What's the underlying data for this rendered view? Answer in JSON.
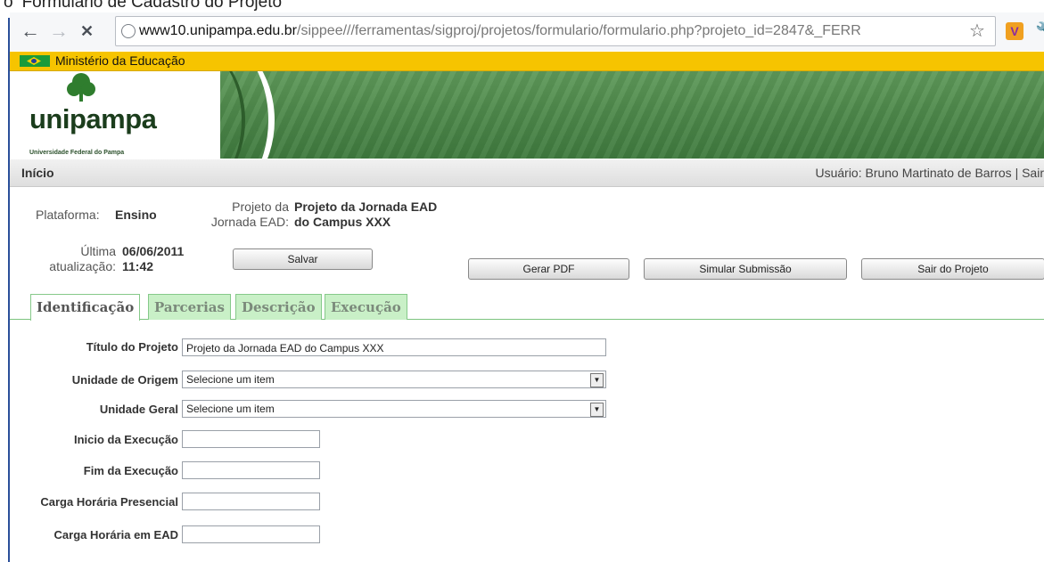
{
  "caption": {
    "text": "Formulário de Cadastro do Projeto"
  },
  "browser": {
    "url_host": "www10.unipampa.edu.br",
    "url_path": "/sippee///ferramentas/sigproj/projetos/formulario/formulario.php?projeto_id=2847&_FERR",
    "back": "←",
    "forward": "→",
    "stop": "✕"
  },
  "ministry": {
    "label": "Ministério da Educação"
  },
  "header": {
    "logo_word": "unipampa",
    "logo_sub": "Universidade Federal do Pampa"
  },
  "nav": {
    "home": "Início",
    "user": "Usuário: Bruno Martinato de Barros | Sair"
  },
  "info": {
    "platform_label": "Plataforma:",
    "platform_value": "Ensino",
    "project_label_1": "Projeto da",
    "project_label_2": "Jornada EAD:",
    "project_value_1": "Projeto da Jornada EAD",
    "project_value_2": "do Campus XXX",
    "update_label_1": "Última",
    "update_label_2": "atualização:",
    "update_date": "06/06/2011",
    "update_time": "11:42"
  },
  "buttons": {
    "save": "Salvar",
    "pdf": "Gerar PDF",
    "simulate": "Simular Submissão",
    "exit": "Sair do Projeto"
  },
  "tabs": [
    {
      "label": "Identificação",
      "active": true
    },
    {
      "label": "Parcerias",
      "active": false
    },
    {
      "label": "Descrição",
      "active": false
    },
    {
      "label": "Execução",
      "active": false
    }
  ],
  "form": {
    "title_label": "Título do Projeto",
    "title_value": "Projeto da Jornada EAD do Campus XXX",
    "origin_label": "Unidade de Origem",
    "origin_value": "Selecione um item",
    "general_label": "Unidade Geral",
    "general_value": "Selecione um item",
    "start_label": "Inicio da Execução",
    "start_value": "",
    "end_label": "Fim da Execução",
    "end_value": "",
    "onsite_label": "Carga Horária Presencial",
    "onsite_value": "",
    "ead_label": "Carga Horária em EAD",
    "ead_value": ""
  }
}
